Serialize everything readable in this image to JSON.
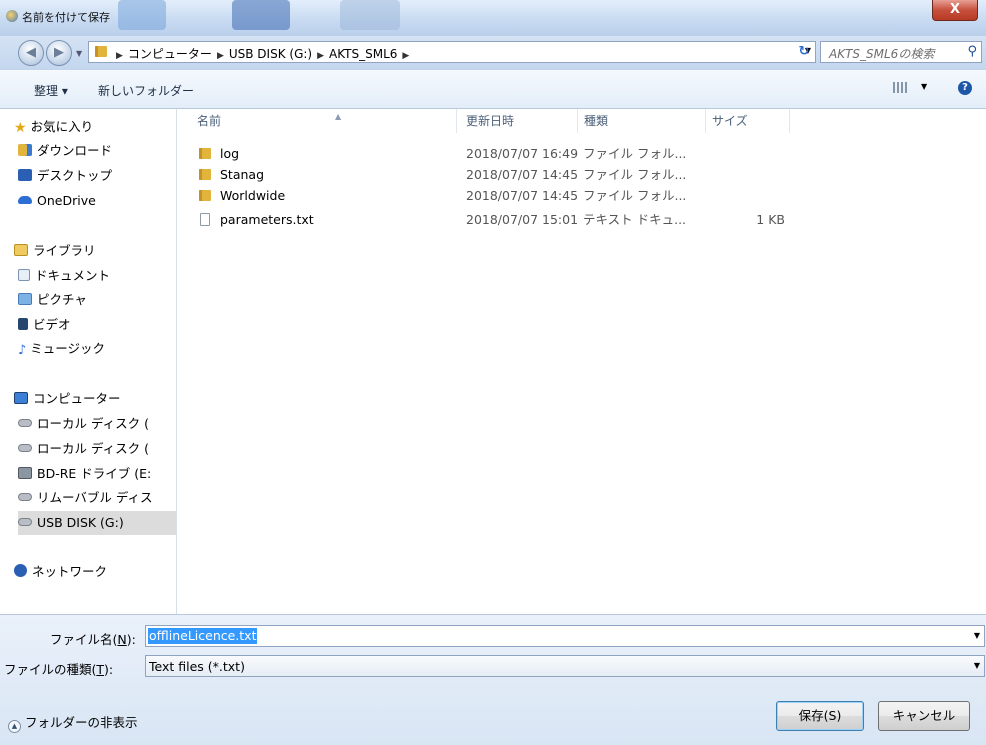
{
  "window": {
    "title": "名前を付けて保存",
    "close_label": "X"
  },
  "nav": {
    "back": "◀",
    "forward": "▶",
    "breadcrumbs": [
      "コンピューター",
      "USB DISK (G:)",
      "AKTS_SML6"
    ],
    "search_placeholder": "AKTS_SML6の検索"
  },
  "toolbar": {
    "organize": "整理 ▾",
    "new_folder": "新しいフォルダー"
  },
  "sidebar": {
    "favorites": {
      "label": "お気に入り",
      "items": [
        "ダウンロード",
        "デスクトップ",
        "OneDrive"
      ]
    },
    "libraries": {
      "label": "ライブラリ",
      "items": [
        "ドキュメント",
        "ピクチャ",
        "ビデオ",
        "ミュージック"
      ]
    },
    "computer": {
      "label": "コンピューター",
      "items": [
        "ローカル ディスク (",
        "ローカル ディスク (",
        "BD-RE ドライブ (E:",
        "リムーバブル ディス",
        "USB DISK (G:)"
      ],
      "selected": "USB DISK (G:)"
    },
    "network": {
      "label": "ネットワーク"
    }
  },
  "columns": {
    "name": "名前",
    "modified": "更新日時",
    "type": "種類",
    "size": "サイズ"
  },
  "files": [
    {
      "name": "log",
      "modified": "2018/07/07 16:49",
      "type": "ファイル フォル...",
      "size": "",
      "kind": "folder"
    },
    {
      "name": "Stanag",
      "modified": "2018/07/07 14:45",
      "type": "ファイル フォル...",
      "size": "",
      "kind": "folder"
    },
    {
      "name": "Worldwide",
      "modified": "2018/07/07 14:45",
      "type": "ファイル フォル...",
      "size": "",
      "kind": "folder"
    },
    {
      "name": "parameters.txt",
      "modified": "2018/07/07 15:01",
      "type": "テキスト ドキュ...",
      "size": "1 KB",
      "kind": "text"
    }
  ],
  "form": {
    "filename_label_pre": "ファイル名(",
    "filename_label_key": "N",
    "filename_label_post": "):",
    "filename_value": "offlineLicence.txt",
    "filetype_label_pre": "ファイルの種類(",
    "filetype_label_key": "T",
    "filetype_label_post": "):",
    "filetype_value": "Text files (*.txt)",
    "hide_folders": "フォルダーの非表示",
    "save": "保存(S)",
    "cancel": "キャンセル"
  }
}
